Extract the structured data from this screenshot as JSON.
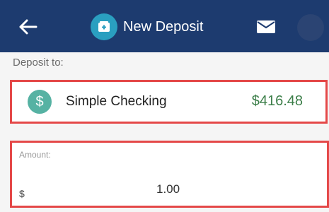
{
  "header": {
    "title": "New Deposit",
    "background_color": "#1d3b6f",
    "icons": [
      "back-arrow-icon",
      "deposit-icon",
      "mail-icon"
    ]
  },
  "deposit_to": {
    "label": "Deposit to:",
    "account": {
      "name": "Simple Checking",
      "balance": "$416.48",
      "badge_symbol": "$",
      "badge_color": "#56b2a3",
      "balance_color": "#3d7f4a"
    }
  },
  "amount": {
    "label": "Amount:",
    "currency_symbol": "$",
    "value": "1.00"
  },
  "highlight_color": "#e44848"
}
